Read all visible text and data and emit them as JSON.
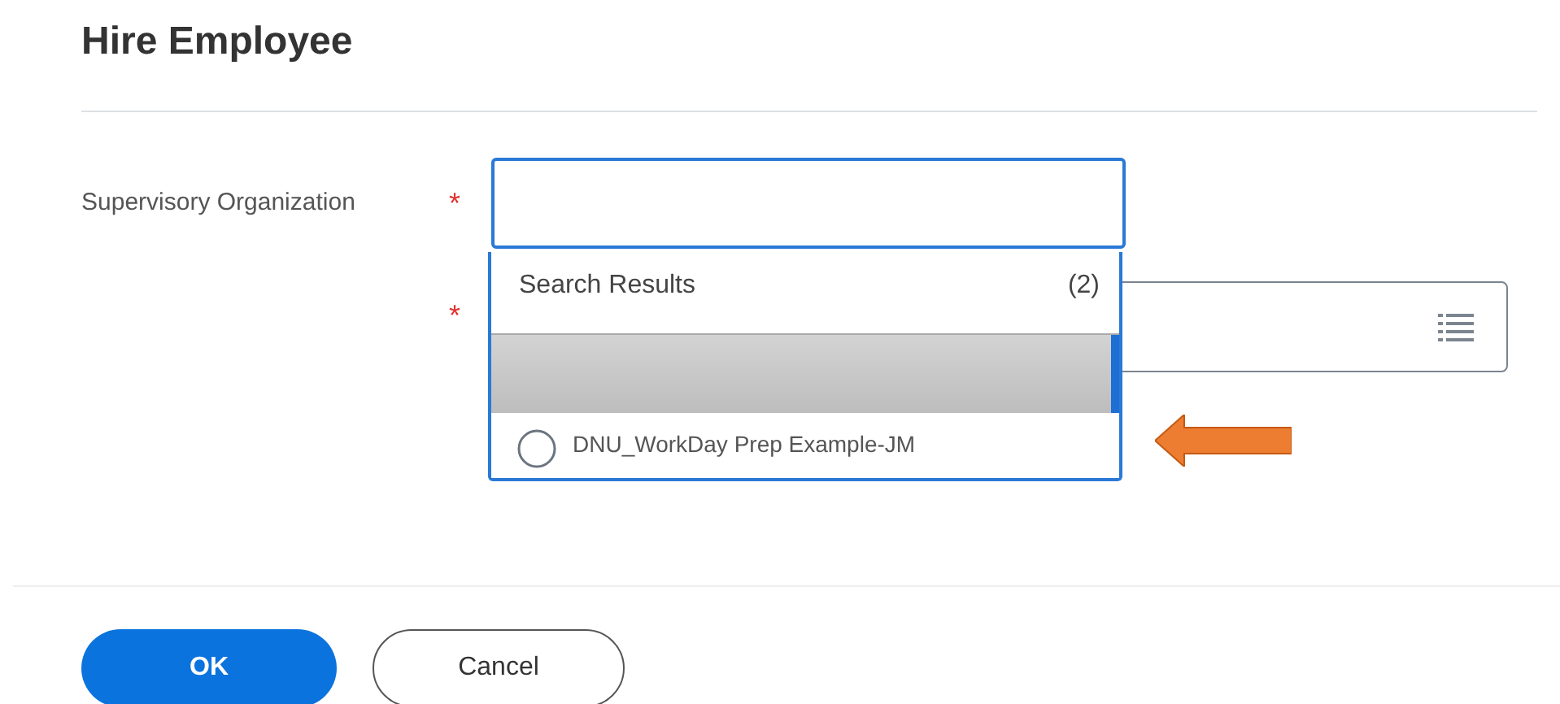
{
  "title": "Hire Employee",
  "fields": [
    {
      "label": "Supervisory Organization",
      "required_mark": "*",
      "focused": true
    },
    {
      "required_mark": "*",
      "focused": false
    }
  ],
  "dropdown": {
    "heading": "Search Results",
    "count": "(2)",
    "results": [
      {
        "kind": "redacted",
        "selected": true
      },
      {
        "kind": "option",
        "label": "DNU_WorkDay Prep Example-JM",
        "selected": false
      }
    ]
  },
  "buttons": [
    {
      "label": "OK",
      "kind": "primary"
    },
    {
      "label": "Cancel",
      "kind": "secondary"
    }
  ]
}
